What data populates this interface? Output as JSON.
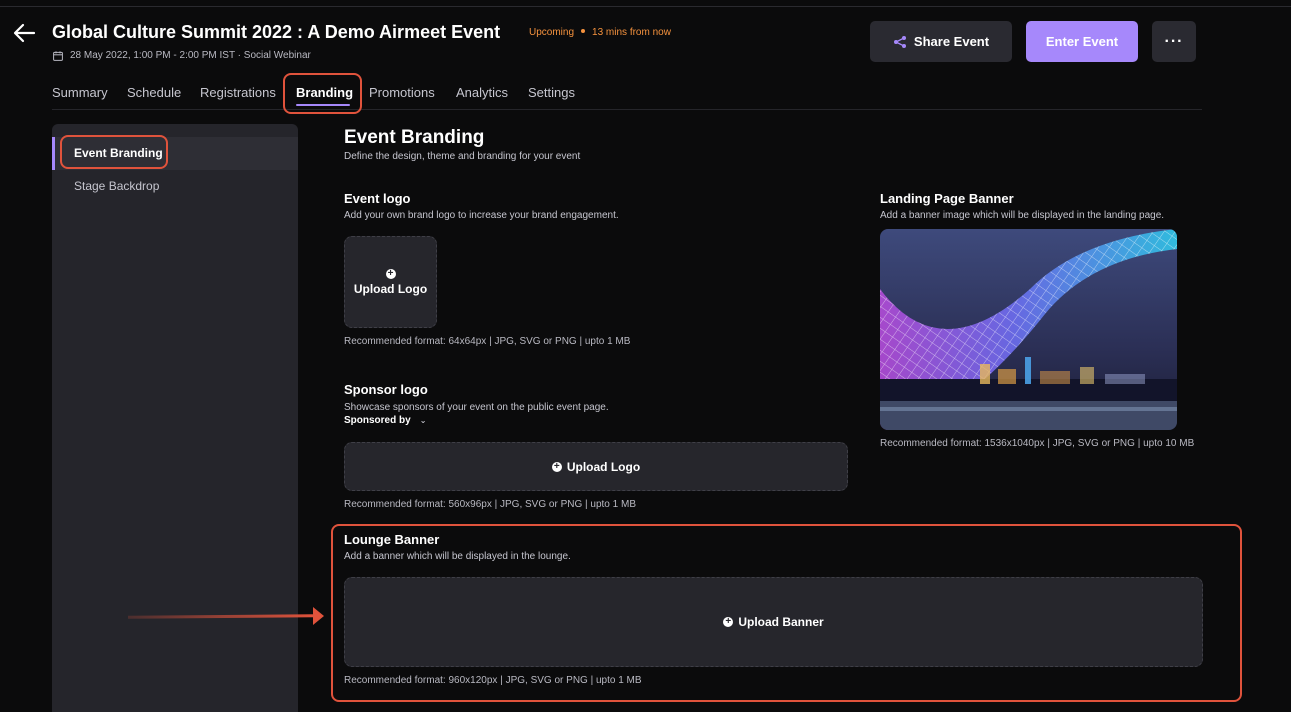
{
  "header": {
    "title": "Global Culture Summit 2022 : A Demo Airmeet Event",
    "status": "Upcoming",
    "time_until": "13 mins from now",
    "meta": "28 May 2022, 1:00 PM - 2:00 PM IST · Social Webinar",
    "share_label": "Share Event",
    "enter_label": "Enter Event",
    "more_label": "···"
  },
  "tabs": [
    "Summary",
    "Schedule",
    "Registrations",
    "Branding",
    "Promotions",
    "Analytics",
    "Settings"
  ],
  "active_tab": "Branding",
  "sidebar": {
    "items": [
      "Event Branding",
      "Stage Backdrop"
    ],
    "active": "Event Branding"
  },
  "main": {
    "title": "Event Branding",
    "subtitle": "Define the design, theme and branding for your event",
    "event_logo": {
      "title": "Event logo",
      "desc": "Add your own brand logo to increase your brand engagement.",
      "upload_label": "Upload Logo",
      "format": "Recommended format: 64x64px | JPG, SVG or PNG | upto 1 MB"
    },
    "landing_banner": {
      "title": "Landing Page Banner",
      "desc": "Add a banner image which will be displayed in the landing page.",
      "format": "Recommended format: 1536x1040px | JPG, SVG or PNG | upto 10 MB"
    },
    "sponsor_logo": {
      "title": "Sponsor logo",
      "desc": "Showcase sponsors of your event on the public event page.",
      "sponsored_by": "Sponsored by",
      "upload_label": "Upload Logo",
      "format": "Recommended format: 560x96px | JPG, SVG or PNG | upto 1 MB"
    },
    "lounge_banner": {
      "title": "Lounge Banner",
      "desc": "Add a banner which will be displayed in the lounge.",
      "upload_label": "Upload Banner",
      "format": "Recommended format: 960x120px | JPG, SVG or PNG | upto 1 MB"
    }
  },
  "colors": {
    "accent": "#a688fb",
    "status": "#f5923e",
    "annotation": "#e0533c",
    "background": "#0b0b0c",
    "panel": "#25252b"
  },
  "icons": [
    "back-arrow-icon",
    "calendar-icon",
    "share-icon",
    "more-icon",
    "plus-circle-icon",
    "chevron-down-icon"
  ]
}
